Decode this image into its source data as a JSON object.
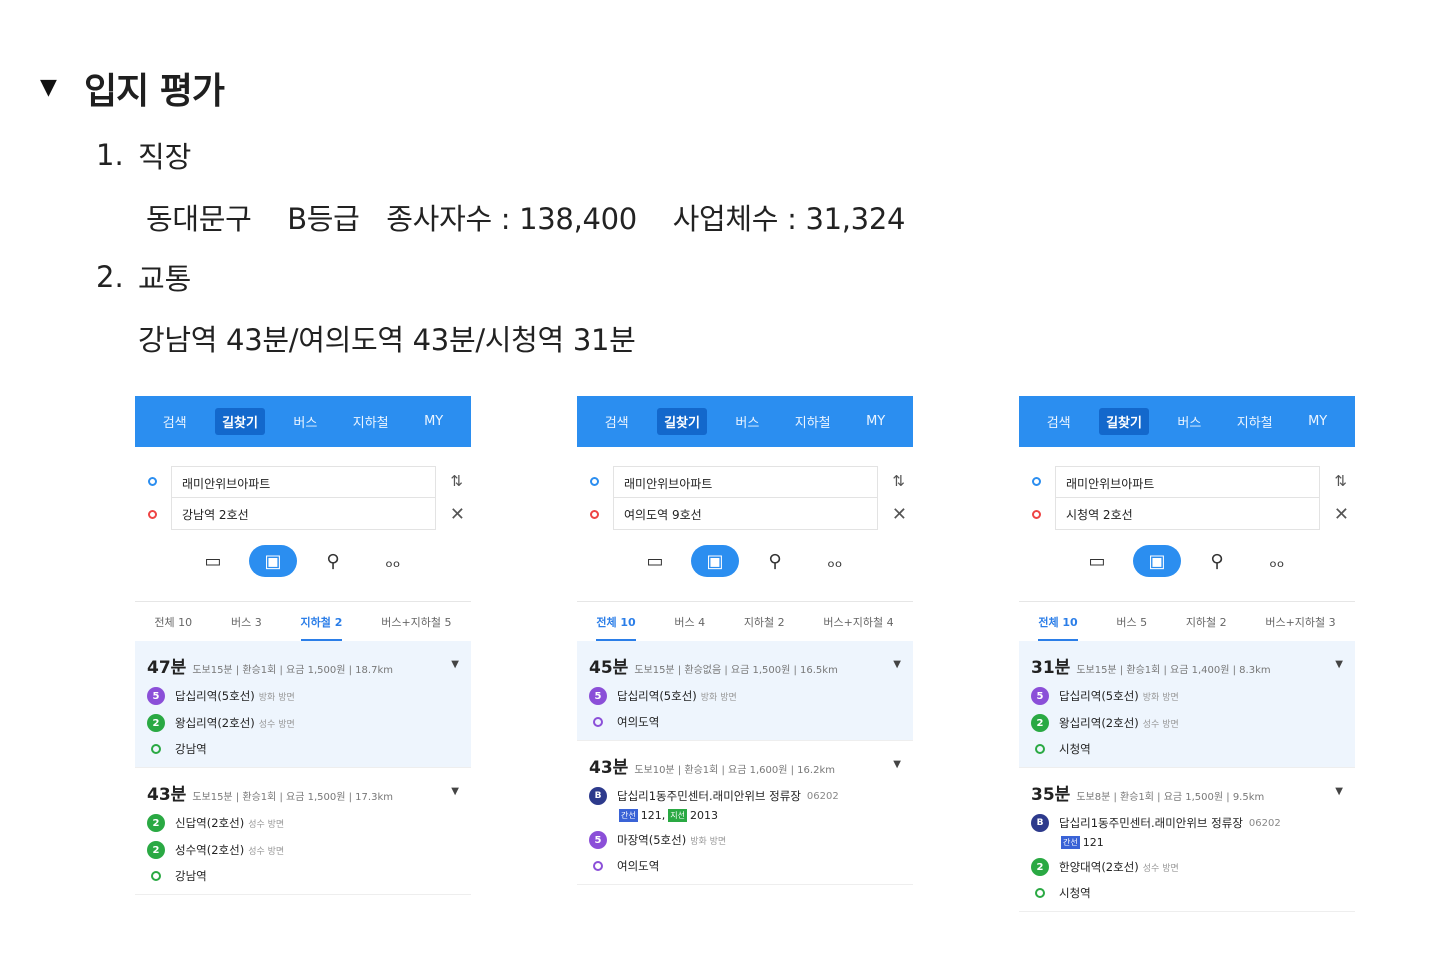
{
  "heading": {
    "toggle": "▼",
    "title": "입지 평가"
  },
  "items": [
    {
      "num": "1.",
      "title": "직장",
      "detail": "동대문구    B등급   종사자수 : 138,400    사업체수 : 31,324"
    },
    {
      "num": "2.",
      "title": "교통",
      "detail": "강남역 43분/여의도역 43분/시청역 31분"
    }
  ],
  "colors": {
    "accent": "#2b8ef0",
    "line5": "#8b4fd8",
    "line2": "#2aa943",
    "bus": "#2d3a8c"
  },
  "panels": [
    {
      "nav": [
        "검색",
        "길찾기",
        "버스",
        "지하철",
        "MY"
      ],
      "nav_active": 1,
      "origin": "래미안위브아파트",
      "destination": "강남역 2호선",
      "modes": [
        "car-icon",
        "bus-icon",
        "walk-icon",
        "bike-icon"
      ],
      "filters": [
        "전체 10",
        "버스 3",
        "지하철 2",
        "버스+지하철 5"
      ],
      "filter_active": 2,
      "results": [
        {
          "time": "47분",
          "meta": "도보15분 | 환승1회 | 요금 1,500원 | 18.7km",
          "stops": [
            {
              "badge": "5",
              "type": "purple",
              "name": "답십리역(5호선)",
              "dir": "방화 방면"
            },
            {
              "badge": "2",
              "type": "green",
              "name": "왕십리역(2호선)",
              "dir": "성수 방면"
            },
            {
              "type": "end-green",
              "name": "강남역"
            }
          ]
        },
        {
          "time": "43분",
          "meta": "도보15분 | 환승1회 | 요금 1,500원 | 17.3km",
          "stops": [
            {
              "badge": "2",
              "type": "green",
              "name": "신답역(2호선)",
              "dir": "성수 방면"
            },
            {
              "badge": "2",
              "type": "green",
              "name": "성수역(2호선)",
              "dir": "성수 방면"
            },
            {
              "type": "end-green",
              "name": "강남역"
            }
          ]
        }
      ]
    },
    {
      "nav": [
        "검색",
        "길찾기",
        "버스",
        "지하철",
        "MY"
      ],
      "nav_active": 1,
      "origin": "래미안위브아파트",
      "destination": "여의도역 9호선",
      "modes": [
        "car-icon",
        "bus-icon",
        "walk-icon",
        "bike-icon"
      ],
      "filters": [
        "전체 10",
        "버스 4",
        "지하철 2",
        "버스+지하철 4"
      ],
      "filter_active": 0,
      "results": [
        {
          "time": "45분",
          "meta": "도보15분 | 환승없음 | 요금 1,500원 | 16.5km",
          "stops": [
            {
              "badge": "5",
              "type": "purple",
              "name": "답십리역(5호선)",
              "dir": "방화 방면"
            },
            {
              "type": "end-purple",
              "name": "여의도역"
            }
          ]
        },
        {
          "time": "43분",
          "meta": "도보10분 | 환승1회 | 요금 1,600원 | 16.2km",
          "stops": [
            {
              "badge": "B",
              "type": "bus",
              "name": "답십리1동주민센터.래미안위브 정류장",
              "code": "06202",
              "lines": [
                {
                  "tag": "간선",
                  "color": "blue",
                  "num": "121,"
                },
                {
                  "tag": "지선",
                  "color": "green",
                  "num": "2013"
                }
              ]
            },
            {
              "badge": "5",
              "type": "purple",
              "name": "마장역(5호선)",
              "dir": "방화 방면"
            },
            {
              "type": "end-purple",
              "name": "여의도역"
            }
          ]
        }
      ]
    },
    {
      "nav": [
        "검색",
        "길찾기",
        "버스",
        "지하철",
        "MY"
      ],
      "nav_active": 1,
      "origin": "래미안위브아파트",
      "destination": "시청역 2호선",
      "modes": [
        "car-icon",
        "bus-icon",
        "walk-icon",
        "bike-icon"
      ],
      "filters": [
        "전체 10",
        "버스 5",
        "지하철 2",
        "버스+지하철 3"
      ],
      "filter_active": 0,
      "results": [
        {
          "time": "31분",
          "meta": "도보15분 | 환승1회 | 요금 1,400원 | 8.3km",
          "stops": [
            {
              "badge": "5",
              "type": "purple",
              "name": "답십리역(5호선)",
              "dir": "방화 방면"
            },
            {
              "badge": "2",
              "type": "green",
              "name": "왕십리역(2호선)",
              "dir": "성수 방면"
            },
            {
              "type": "end-green",
              "name": "시청역"
            }
          ]
        },
        {
          "time": "35분",
          "meta": "도보8분 | 환승1회 | 요금 1,500원 | 9.5km",
          "stops": [
            {
              "badge": "B",
              "type": "bus",
              "name": "답십리1동주민센터.래미안위브 정류장",
              "code": "06202",
              "lines": [
                {
                  "tag": "간선",
                  "color": "blue",
                  "num": "121"
                }
              ]
            },
            {
              "badge": "2",
              "type": "green",
              "name": "한양대역(2호선)",
              "dir": "성수 방면"
            },
            {
              "type": "end-green",
              "name": "시청역"
            }
          ]
        }
      ]
    }
  ]
}
